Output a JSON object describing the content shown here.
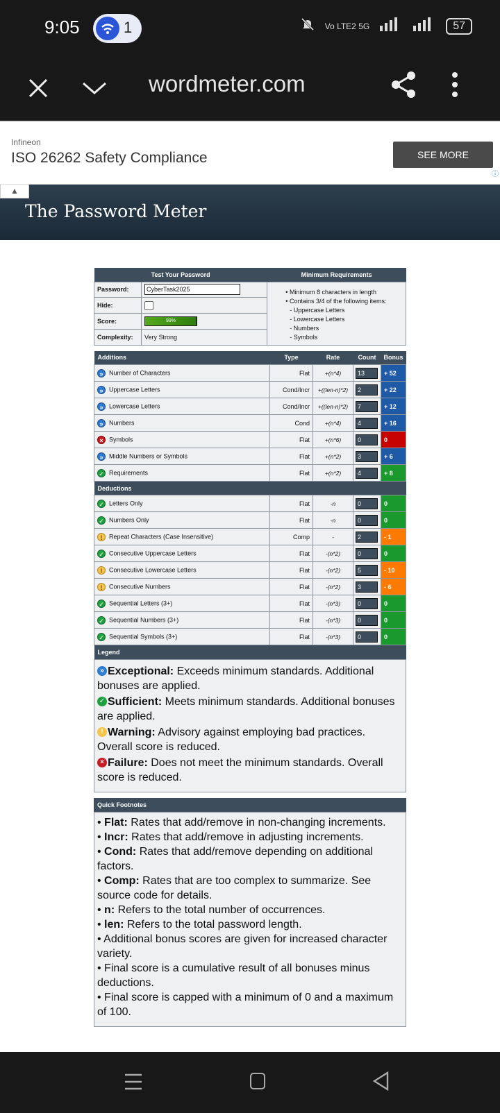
{
  "status_bar": {
    "time": "9:05",
    "notification_count": "1",
    "network": "Vo LTE2 5G",
    "battery": "57"
  },
  "browser": {
    "url": "wordmeter.com"
  },
  "ad": {
    "brand": "Infineon",
    "headline": "ISO 26262 Safety Compliance",
    "cta": "SEE MORE"
  },
  "site": {
    "title": "The Password Meter"
  },
  "test_form": {
    "header_left": "Test Your Password",
    "header_right": "Minimum Requirements",
    "password_label": "Password:",
    "password_value": "CyberTask2025",
    "hide_label": "Hide:",
    "score_label": "Score:",
    "score_text": "99%",
    "score_value": 99,
    "complexity_label": "Complexity:",
    "complexity_value": "Very Strong",
    "requirements": {
      "items": [
        "Minimum 8 characters in length",
        "Contains 3/4 of the following items:"
      ],
      "subitems": [
        "- Uppercase Letters",
        "- Lowercase Letters",
        "- Numbers",
        "- Symbols"
      ]
    }
  },
  "rates_table": {
    "headers": {
      "additions": "Additions",
      "type": "Type",
      "rate": "Rate",
      "count": "Count",
      "bonus": "Bonus",
      "deductions": "Deductions",
      "legend": "Legend"
    },
    "additions": [
      {
        "status": "exceptional",
        "name": "Number of Characters",
        "type": "Flat",
        "rate": "+(n*4)",
        "count": "13",
        "bonus": "+ 52",
        "bonus_color": "#1f5aa6"
      },
      {
        "status": "exceptional",
        "name": "Uppercase Letters",
        "type": "Cond/Incr",
        "rate": "+((len-n)*2)",
        "count": "2",
        "bonus": "+ 22",
        "bonus_color": "#1f5aa6"
      },
      {
        "status": "exceptional",
        "name": "Lowercase Letters",
        "type": "Cond/Incr",
        "rate": "+((len-n)*2)",
        "count": "7",
        "bonus": "+ 12",
        "bonus_color": "#1f5aa6"
      },
      {
        "status": "exceptional",
        "name": "Numbers",
        "type": "Cond",
        "rate": "+(n*4)",
        "count": "4",
        "bonus": "+ 16",
        "bonus_color": "#1f5aa6"
      },
      {
        "status": "failure",
        "name": "Symbols",
        "type": "Flat",
        "rate": "+(n*6)",
        "count": "0",
        "bonus": "0",
        "bonus_color": "#c70000"
      },
      {
        "status": "exceptional",
        "name": "Middle Numbers or Symbols",
        "type": "Flat",
        "rate": "+(n*2)",
        "count": "3",
        "bonus": "+ 6",
        "bonus_color": "#1f5aa6"
      },
      {
        "status": "sufficient",
        "name": "Requirements",
        "type": "Flat",
        "rate": "+(n*2)",
        "count": "4",
        "bonus": "+ 8",
        "bonus_color": "#1a9a2c"
      }
    ],
    "deductions": [
      {
        "status": "sufficient",
        "name": "Letters Only",
        "type": "Flat",
        "rate": "-n",
        "count": "0",
        "bonus": "0",
        "bonus_color": "#1a9a2c"
      },
      {
        "status": "sufficient",
        "name": "Numbers Only",
        "type": "Flat",
        "rate": "-n",
        "count": "0",
        "bonus": "0",
        "bonus_color": "#1a9a2c"
      },
      {
        "status": "warning",
        "name": "Repeat Characters (Case Insensitive)",
        "type": "Comp",
        "rate": "-",
        "count": "2",
        "bonus": "- 1",
        "bonus_color": "#ff7a00"
      },
      {
        "status": "sufficient",
        "name": "Consecutive Uppercase Letters",
        "type": "Flat",
        "rate": "-(n*2)",
        "count": "0",
        "bonus": "0",
        "bonus_color": "#1a9a2c"
      },
      {
        "status": "warning",
        "name": "Consecutive Lowercase Letters",
        "type": "Flat",
        "rate": "-(n*2)",
        "count": "5",
        "bonus": "- 10",
        "bonus_color": "#ff7a00"
      },
      {
        "status": "warning",
        "name": "Consecutive Numbers",
        "type": "Flat",
        "rate": "-(n*2)",
        "count": "3",
        "bonus": "- 6",
        "bonus_color": "#ff7a00"
      },
      {
        "status": "sufficient",
        "name": "Sequential Letters (3+)",
        "type": "Flat",
        "rate": "-(n*3)",
        "count": "0",
        "bonus": "0",
        "bonus_color": "#1a9a2c"
      },
      {
        "status": "sufficient",
        "name": "Sequential Numbers (3+)",
        "type": "Flat",
        "rate": "-(n*3)",
        "count": "0",
        "bonus": "0",
        "bonus_color": "#1a9a2c"
      },
      {
        "status": "sufficient",
        "name": "Sequential Symbols (3+)",
        "type": "Flat",
        "rate": "-(n*3)",
        "count": "0",
        "bonus": "0",
        "bonus_color": "#1a9a2c"
      }
    ]
  },
  "legend": [
    {
      "status": "exceptional",
      "term": "Exceptional:",
      "text": " Exceeds minimum standards. Additional bonuses are applied."
    },
    {
      "status": "sufficient",
      "term": "Sufficient:",
      "text": " Meets minimum standards. Additional bonuses are applied."
    },
    {
      "status": "warning",
      "term": "Warning:",
      "text": " Advisory against employing bad practices. Overall score is reduced."
    },
    {
      "status": "failure",
      "term": "Failure:",
      "text": " Does not meet the minimum standards. Overall score is reduced."
    }
  ],
  "footnotes": {
    "title": "Quick Footnotes",
    "items": [
      {
        "term": "Flat:",
        "text": " Rates that add/remove in non-changing increments."
      },
      {
        "term": "Incr:",
        "text": " Rates that add/remove in adjusting increments."
      },
      {
        "term": "Cond:",
        "text": " Rates that add/remove depending on additional factors."
      },
      {
        "term": "Comp:",
        "text": " Rates that are too complex to summarize. See source code for details."
      },
      {
        "term": "n:",
        "text": " Refers to the total number of occurrences."
      },
      {
        "term": "len:",
        "text": " Refers to the total password length."
      },
      {
        "term": "",
        "text": "Additional bonus scores are given for increased character variety."
      },
      {
        "term": "",
        "text": "Final score is a cumulative result of all bonuses minus deductions."
      },
      {
        "term": "",
        "text": "Final score is capped with a minimum of 0 and a maximum of 100."
      }
    ]
  },
  "colors": {
    "exceptional": "#2e7dd1",
    "sufficient": "#1fa13f",
    "warning": "#f3c54b",
    "failure": "#c61d24",
    "header_bg": "#3d4d5b",
    "site_header": "#23333f"
  }
}
